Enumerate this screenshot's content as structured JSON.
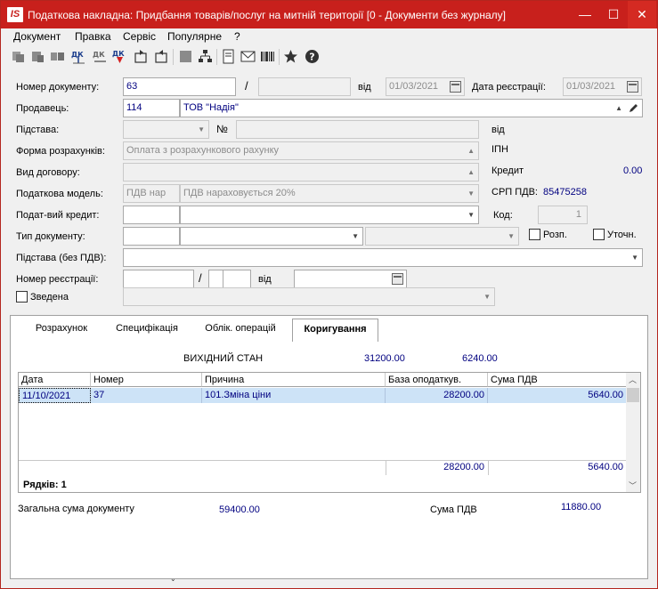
{
  "window": {
    "title": "Податкова накладна: Придбання товарів/послуг на митній території [0 - Документи без журналу]",
    "app_icon": "IS",
    "minimize": "—",
    "maximize": "☐",
    "close": "✕"
  },
  "menu": [
    "Документ",
    "Правка",
    "Сервіс",
    "Популярне",
    "?"
  ],
  "toolbar_icons": [
    "copy-icon",
    "paste-icon",
    "cut-icon",
    "debit-credit-icon",
    "debit-credit-balance-icon",
    "debit-credit-down-icon",
    "export-icon",
    "import-icon",
    "stop-icon",
    "hierarchy-icon",
    "document-icon",
    "mail-icon",
    "barcode-icon",
    "star-icon",
    "help-icon"
  ],
  "form": {
    "doc_number_label": "Номер документу:",
    "doc_number": "63",
    "slash": "/",
    "from_label": "від",
    "doc_date": "01/03/2021",
    "reg_date_label": "Дата реєстрації:",
    "reg_date": "01/03/2021",
    "seller_label": "Продавець:",
    "seller_code": "114",
    "seller_name": "ТОВ \"Надія\"",
    "basis_label": "Підстава:",
    "no_label": "№",
    "basis_from_label": "від",
    "payment_form_label": "Форма розрахунків:",
    "payment_form": "Оплата з розрахункового рахунку",
    "ipn_label": "ІПН",
    "contract_label": "Вид договору:",
    "credit_label": "Кредит",
    "credit_value": "0.00",
    "tax_model_label": "Податкова модель:",
    "tax_model_code": "ПДВ нар",
    "tax_model_name": "ПДВ нараховується 20%",
    "srp_label": "СРП ПДВ:",
    "srp_value": "85475258",
    "tax_credit_label": "Подат-вий кредит:",
    "code_label": "Код:",
    "code_value": "1",
    "doc_type_label": "Тип документу:",
    "rozp_label": "Розп.",
    "utochn_label": "Уточн.",
    "basis_no_vat_label": "Підстава (без ПДВ):",
    "reg_number_label": "Номер реєстрації:",
    "reg_slash": "/",
    "reg_from_label": "від",
    "consolidated_label": "Зведена"
  },
  "tabs": [
    "Розрахунок",
    "Специфікація",
    "Облік. операцій",
    "Коригування"
  ],
  "active_tab": "Коригування",
  "correction": {
    "initial_state_label": "ВИХІДНИЙ СТАН",
    "initial_base": "31200.00",
    "initial_vat": "6240.00",
    "columns": [
      "Дата",
      "Номер",
      "Причина",
      "База оподаткув.",
      "Сума ПДВ"
    ],
    "rows": [
      {
        "date": "11/10/2021",
        "number": "37",
        "reason": "101.Зміна ціни",
        "base": "28200.00",
        "vat": "5640.00"
      }
    ],
    "total_base": "28200.00",
    "total_vat": "5640.00",
    "rows_count_label": "Рядків: 1",
    "doc_total_label": "Загальна сума документу",
    "doc_total_value": "59400.00",
    "vat_sum_label": "Сума ПДВ",
    "vat_sum_value": "11880.00"
  },
  "colors": {
    "titlebar": "#c8201c",
    "value_text": "#000080",
    "row_highlight": "#cde3f7"
  }
}
